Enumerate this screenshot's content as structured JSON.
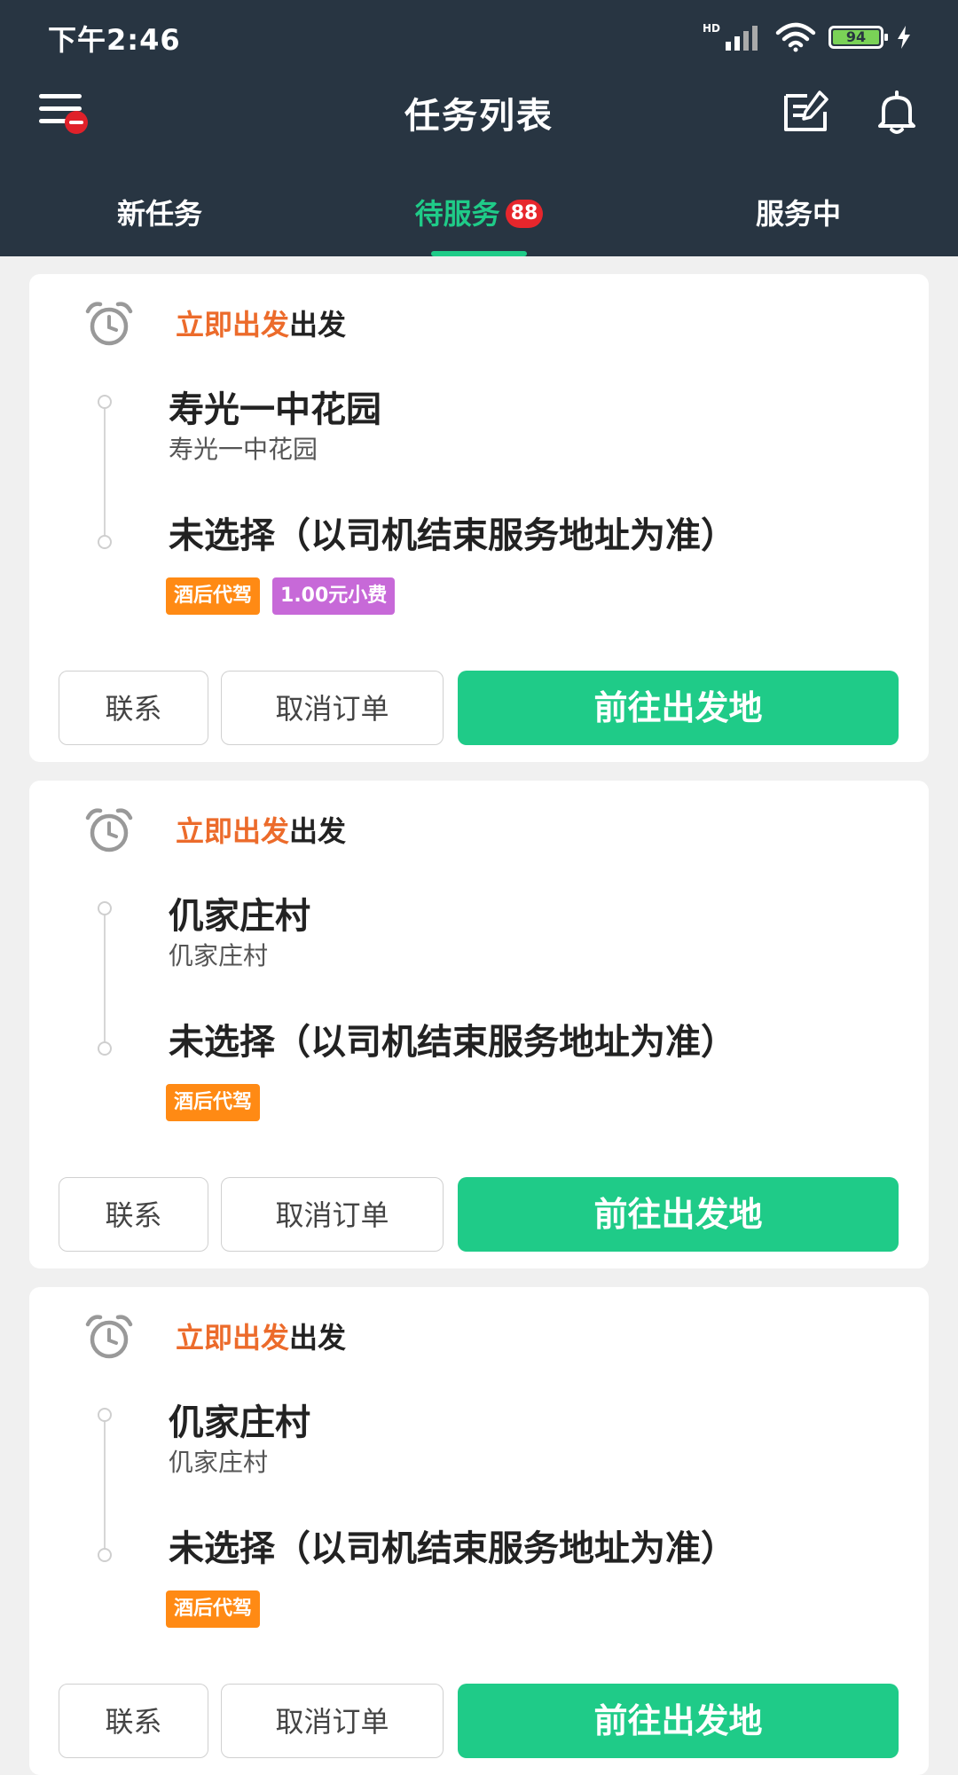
{
  "status_bar": {
    "time": "下午2:46",
    "network": "HD",
    "battery": "94"
  },
  "header": {
    "title": "任务列表"
  },
  "tabs": [
    {
      "label": "新任务"
    },
    {
      "label": "待服务",
      "badge": "88"
    },
    {
      "label": "服务中"
    }
  ],
  "cards": [
    {
      "depart_accent": "立即出发",
      "depart_suffix": "出发",
      "from_name": "寿光一中花园",
      "from_sub": "寿光一中花园",
      "to_name": "未选择（以司机结束服务地址为准）",
      "tags": [
        "酒后代驾",
        "1.00元小费"
      ],
      "btn_contact": "联系",
      "btn_cancel": "取消订单",
      "btn_go": "前往出发地"
    },
    {
      "depart_accent": "立即出发",
      "depart_suffix": "出发",
      "from_name": "仉家庄村",
      "from_sub": "仉家庄村",
      "to_name": "未选择（以司机结束服务地址为准）",
      "tags": [
        "酒后代驾"
      ],
      "btn_contact": "联系",
      "btn_cancel": "取消订单",
      "btn_go": "前往出发地"
    },
    {
      "depart_accent": "立即出发",
      "depart_suffix": "出发",
      "from_name": "仉家庄村",
      "from_sub": "仉家庄村",
      "to_name": "未选择（以司机结束服务地址为准）",
      "tags": [
        "酒后代驾"
      ],
      "btn_contact": "联系",
      "btn_cancel": "取消订单",
      "btn_go": "前往出发地"
    }
  ],
  "colors": {
    "header_bg": "#283542",
    "accent_green": "#1fcb88",
    "accent_orange": "#ec6b2b",
    "tag_orange": "#ff8a14",
    "tag_purple": "#c769d8",
    "badge_red": "#e7262c"
  },
  "icons": [
    "menu-icon",
    "edit-icon",
    "bell-icon",
    "alarm-clock-icon",
    "signal-icon",
    "wifi-icon",
    "battery-icon",
    "charging-icon"
  ]
}
